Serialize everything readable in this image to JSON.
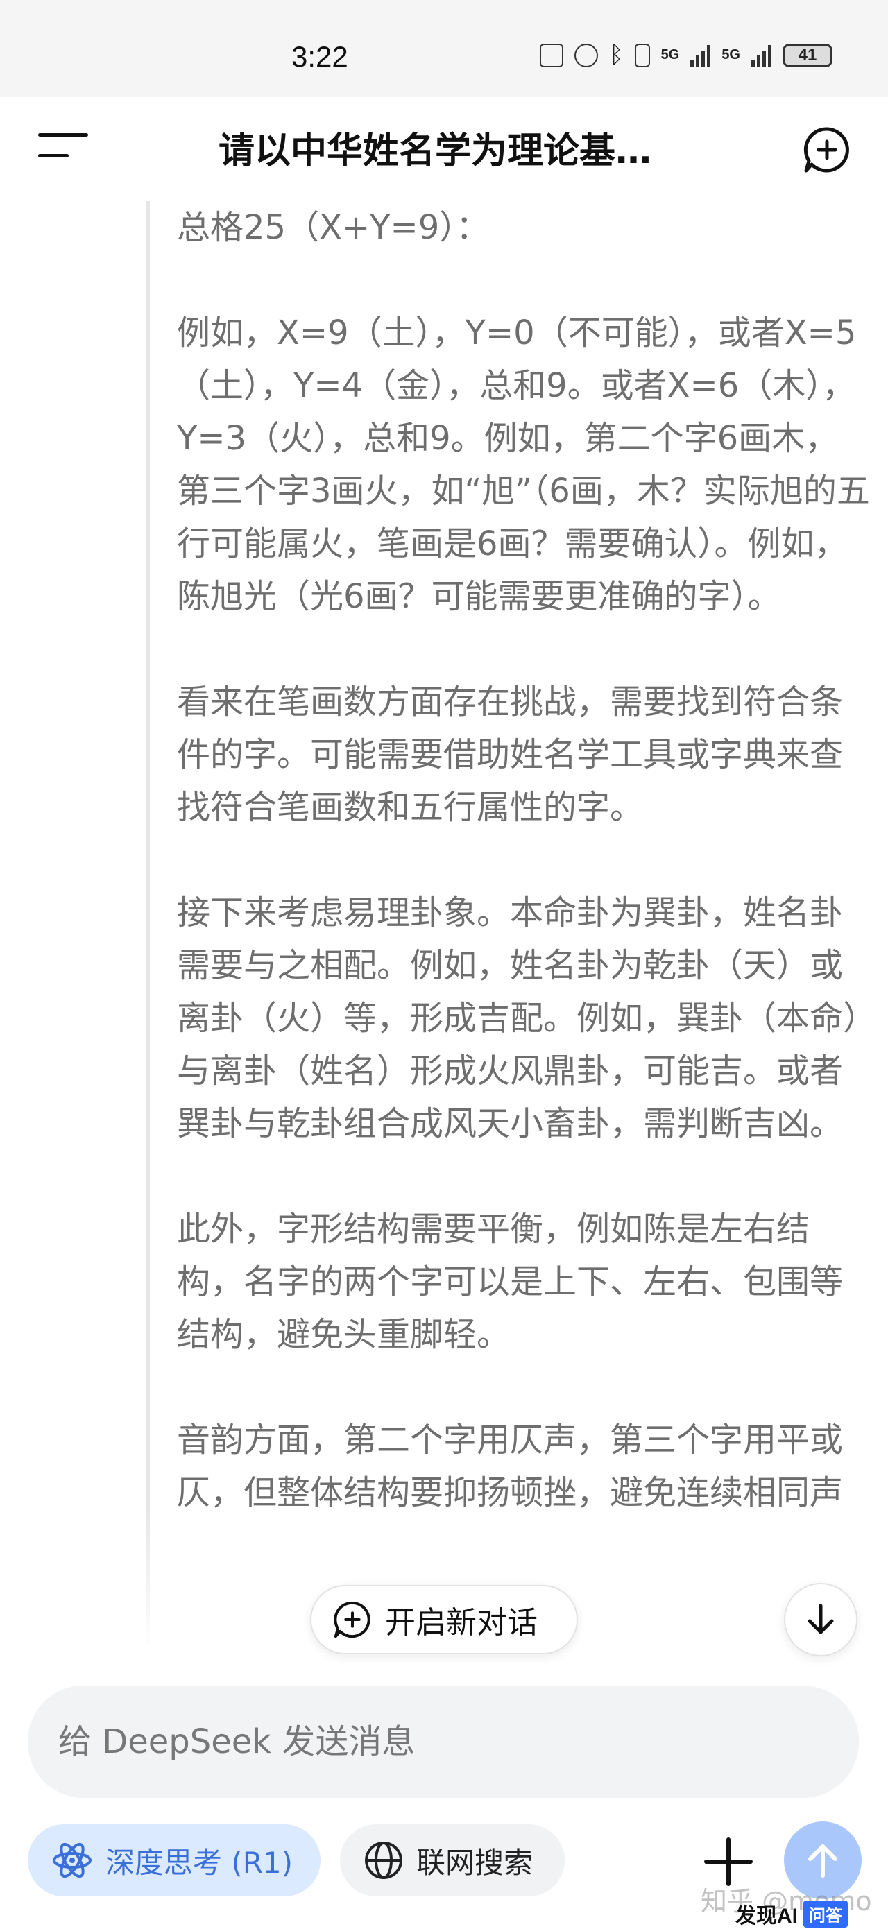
{
  "status_bar": {
    "time": "3:22",
    "network": "5G",
    "battery": "41"
  },
  "header": {
    "title": "请以中华姓名学为理论基…"
  },
  "thinking": {
    "paragraphs": [
      "总格25（X+Y=9）：",
      "例如，X=9（土），Y=0（不可能），或者X=5（土），Y=4（金），总和9。或者X=6（木），Y=3（火），总和9。例如，第二个字6画木，第三个字3画火，如“旭”（6画，木？实际旭的五行可能属火，笔画是6画？需要确认）。例如，陈旭光（光6画？可能需要更准确的字）。",
      "看来在笔画数方面存在挑战，需要找到符合条件的字。可能需要借助姓名学工具或字典来查找符合笔画数和五行属性的字。",
      "接下来考虑易理卦象。本命卦为巽卦，姓名卦需要与之相配。例如，姓名卦为乾卦（天）或离卦（火）等，形成吉配。例如，巽卦（本命）与离卦（姓名）形成火风鼎卦，可能吉。或者巽卦与乾卦组合成风天小畜卦，需判断吉凶。",
      "此外，字形结构需要平衡，例如陈是左右结构，名字的两个字可以是上下、左右、包围等结构，避免头重脚轻。",
      "音韵方面，第二个字用仄声，第三个字用平或仄，但整体结构要抑扬顿挫，避免连续相同声"
    ]
  },
  "floating": {
    "new_chat_label": "开启新对话"
  },
  "composer": {
    "placeholder": "给 DeepSeek 发送消息"
  },
  "toolbar": {
    "deep_think_label": "深度思考 (R1)",
    "web_search_label": "联网搜索"
  },
  "watermark": {
    "text": "知乎 @momo",
    "badge_brand": "发现AI",
    "badge_tag": "问答"
  },
  "colors": {
    "accent": "#3b6fd8",
    "send_button": "#a9c7fb",
    "thinking_text": "#6e6e6e"
  }
}
